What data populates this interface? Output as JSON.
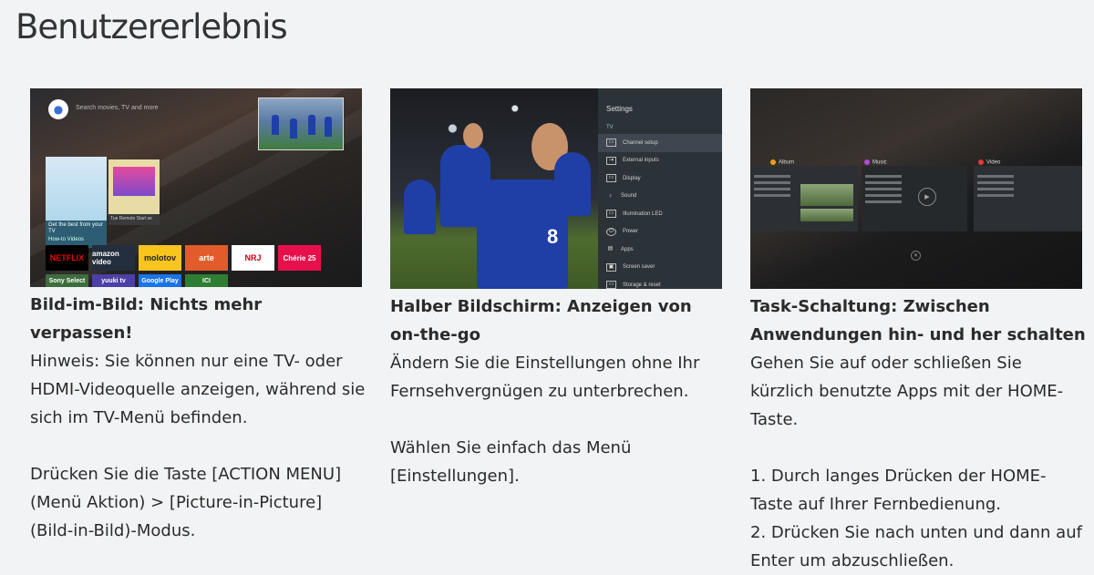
{
  "page": {
    "title": "Benutzererlebnis"
  },
  "columns": [
    {
      "heading": "Bild-im-Bild: Nichts mehr verpassen!",
      "paragraph1": "Hinweis: Sie können nur eine TV- oder HDMI-Videoquelle anzeigen, während sie sich im TV-Menü befinden.",
      "paragraph2": "Drücken Sie die Taste [ACTION MENU] (Menü Aktion) > [Picture-in-Picture] (Bild-in-Bild)-Modus.",
      "screen": {
        "search_hint": "Search movies, TV and more",
        "card_caption": "Get the best from your TV",
        "card_sub": "How-to Videos",
        "card2_caption": "Tue Remote Start se",
        "tiles": [
          "NETFLIX",
          "amazon video",
          "molotov",
          "arte",
          "NRJ",
          "Chérie 25"
        ],
        "small_tiles": [
          "Sony Select",
          "yuuki tv",
          "Google Play",
          "ICI"
        ]
      }
    },
    {
      "heading": "Halber Bildschirm: Anzeigen von on-the-go",
      "paragraph1": "Ändern Sie die Einstellungen ohne Ihr Fernsehvergnügen zu unterbrechen.",
      "paragraph2": "Wählen Sie einfach das Menü [Einstellungen].",
      "screen": {
        "menu_title": "Settings",
        "menu_section": "TV",
        "jersey_number": "8",
        "menu_items": [
          "Channel setup",
          "External inputs",
          "Display",
          "Sound",
          "Illumination LED",
          "Power",
          "Apps",
          "Screen saver",
          "Storage & reset"
        ]
      }
    },
    {
      "heading": "Task-Schaltung: Zwischen Anwendungen hin- und her schalten",
      "paragraph1": "Gehen Sie auf oder schließen Sie kürzlich benutzte Apps mit der HOME-Taste.",
      "step1": "1. Durch langes Drücken der HOME-Taste auf Ihrer Fernbedienung.",
      "step2": "2. Drücken Sie nach unten und dann auf Enter um abzuschließen.",
      "screen": {
        "apps": [
          "Album",
          "Music",
          "Video"
        ]
      }
    }
  ],
  "colors": {
    "background": "#f2f3f5",
    "text": "#2b2b2b"
  }
}
